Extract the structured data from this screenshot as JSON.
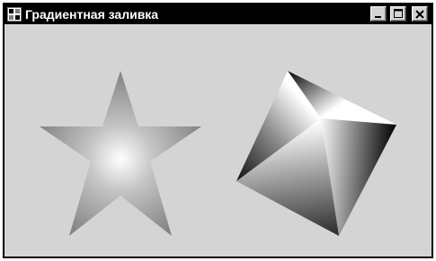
{
  "window": {
    "title": "Градиентная заливка",
    "controls": {
      "minimize": "minimize-icon",
      "maximize": "maximize-icon",
      "close": "close-icon"
    }
  },
  "canvas": {
    "shapes": [
      {
        "name": "star",
        "fill": "center-gradient",
        "center_color": "#ffffff",
        "edge_color": "#7a7a7a"
      },
      {
        "name": "square",
        "fill": "path-gradient",
        "highlight_color": "#ffffff",
        "edge_color": "#000000"
      }
    ]
  },
  "colors": {
    "titlebar": "#000000",
    "title_text": "#ffffff",
    "client_background": "#d4d4d4",
    "button_face": "#d4d4d4"
  }
}
